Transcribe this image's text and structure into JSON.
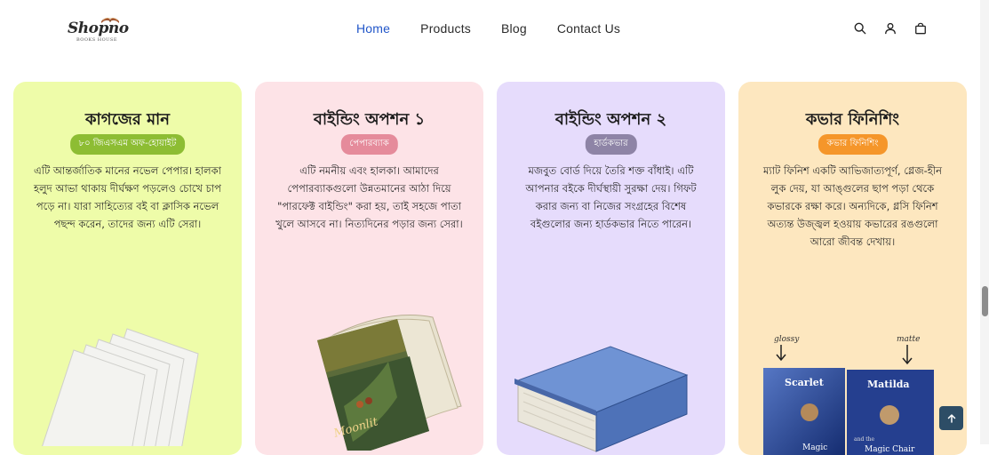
{
  "header": {
    "logo_text": "Shopno",
    "logo_sub": "BOOKS HOUSE",
    "nav": [
      "Home",
      "Products",
      "Blog",
      "Contact Us"
    ],
    "icons": [
      "search-icon",
      "user-icon",
      "cart-icon"
    ]
  },
  "cards": [
    {
      "title": "কাগজের মান",
      "badge": "৮০ জিএসএম অফ-হোয়াইট",
      "text": "এটি আন্তর্জাতিক মানের নভেল পেপার। হালকা হলুদ আভা থাকায় দীর্ঘক্ষণ পড়লেও চোখে চাপ পড়ে না। যারা সাহিত্যের বই বা ক্লাসিক নভেল পছন্দ করেন, তাদের জন্য এটি সেরা।",
      "bg": "#eefca9",
      "badge_color": "#8dbd33"
    },
    {
      "title": "বাইন্ডিং অপশন ১",
      "badge": "পেপারব্যাক",
      "text": "এটি নমনীয় এবং হালকা। আমাদের পেপারব্যাকগুলো উন্নতমানের আঠা দিয়ে \"পারফেক্ট বাইন্ডিং\" করা হয়, তাই সহজে পাতা খুলে আসবে না। নিত্যদিনের পড়ার জন্য সেরা।",
      "bg": "#fde3e7",
      "badge_color": "#e58b9b"
    },
    {
      "title": "বাইন্ডিং অপশন ২",
      "badge": "হার্ডকভার",
      "text": "মজবুত বোর্ড দিয়ে তৈরি শক্ত বাঁধাই। এটি আপনার বইকে দীর্ঘস্থায়ী সুরক্ষা দেয়। গিফট করার জন্য বা নিজের সংগ্রহের বিশেষ বইগুলোর জন্য হার্ডকভার নিতে পারেন।",
      "bg": "#e6dcfc",
      "badge_color": "#8e84a6"
    },
    {
      "title": "কভার ফিনিশিং",
      "badge": "কভার ফিনিশিং",
      "text": "ম্যাট ফিনিশ একটি আভিজাত্যপূর্ণ, গ্লেজ-হীন লুক দেয়, যা আঙ্গুলের ছাপ পড়া থেকে কভারকে রক্ষা করে। অন্যদিকে, গ্লসি ফিনিশ অত্যন্ত উজ্জ্বল হওয়ায় কভারের রঙগুলো আরো জীবন্ত দেখায়।",
      "bg": "#fde7bf",
      "badge_color": "#f5962a"
    }
  ],
  "illustrations": {
    "paperback_cover_text": "Moonlit",
    "glossy_label": "glossy",
    "matte_label": "matte",
    "book1_title": "Scarlet",
    "book2_title": "Matilda",
    "book1_sub": "Magic",
    "book2_sub": "Magic Chair",
    "book2_sub_small": "and the"
  },
  "scroll_top_icon": "arrow-up-icon"
}
